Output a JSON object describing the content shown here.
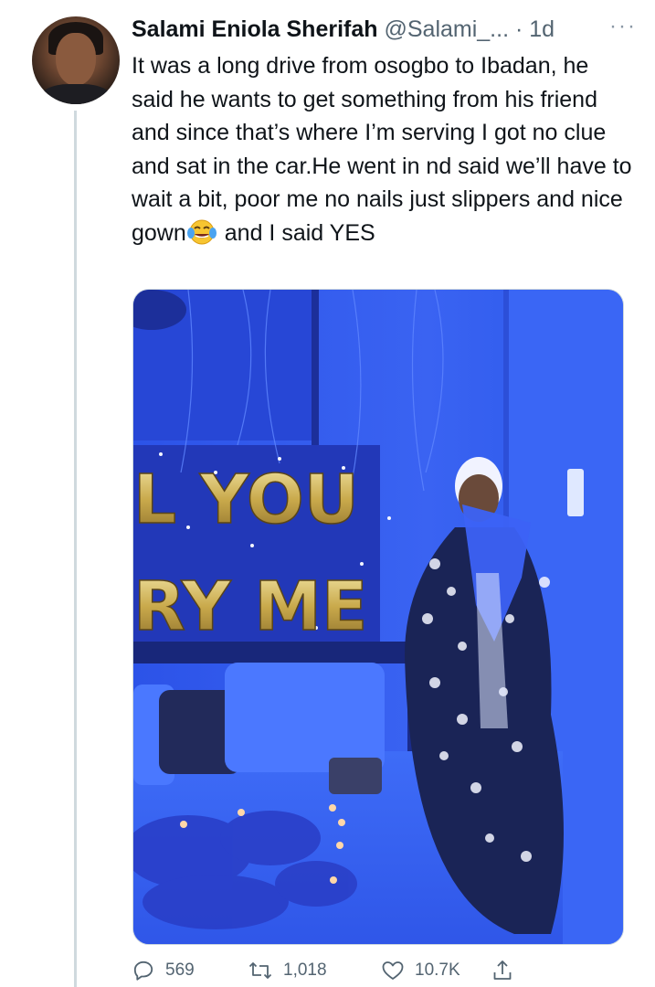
{
  "tweet": {
    "author_name": "Salami Eniola Sherifah",
    "author_handle": "@Salami_...",
    "separator": "·",
    "time": "1d",
    "more": "···",
    "text_before_emoji": "It was a long drive from osogbo to Ibadan, he said he wants to get something from his friend and since that’s where I’m serving I got no clue and sat in the car.He went in nd said we’ll have to wait a bit, poor me no nails just slippers and nice gown",
    "emoji": "face-with-tears-of-joy",
    "text_after_emoji": "and I said YES",
    "photo": {
      "balloon_line1": "L YOU",
      "balloon_line2": "RY ME"
    }
  },
  "actions": {
    "reply_count": "569",
    "retweet_count": "1,018",
    "like_count": "10.7K",
    "icons": [
      "reply-icon",
      "retweet-icon",
      "like-icon",
      "share-icon"
    ]
  },
  "colors": {
    "text": "#0f1419",
    "secondary": "#536471",
    "thread_line": "#cfd9de",
    "photo_blue": "#2f5cf0"
  }
}
